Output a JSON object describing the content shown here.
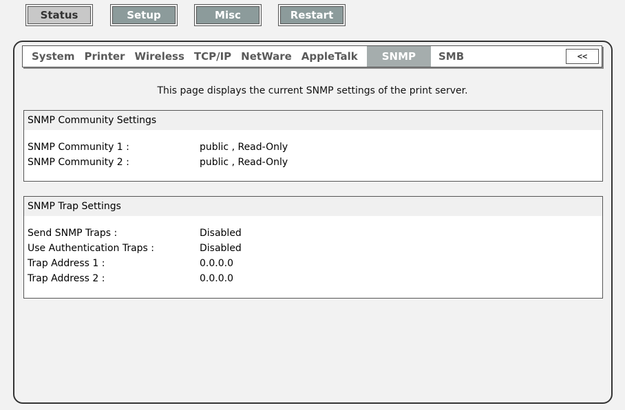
{
  "top_nav": {
    "status": "Status",
    "setup": "Setup",
    "misc": "Misc",
    "restart": "Restart"
  },
  "tabs": {
    "system": "System",
    "printer": "Printer",
    "wireless": "Wireless",
    "tcpip": "TCP/IP",
    "netware": "NetWare",
    "appletalk": "AppleTalk",
    "snmp": "SNMP",
    "smb": "SMB",
    "collapse": "<<"
  },
  "description": "This page displays the current SNMP settings of the print server.",
  "community": {
    "title": "SNMP Community Settings",
    "rows": [
      {
        "label": "SNMP Community 1 :",
        "value": "public , Read-Only"
      },
      {
        "label": "SNMP Community 2 :",
        "value": "public , Read-Only"
      }
    ]
  },
  "trap": {
    "title": "SNMP Trap Settings",
    "rows": [
      {
        "label": "Send SNMP Traps :",
        "value": "Disabled"
      },
      {
        "label": "Use Authentication Traps :",
        "value": "Disabled"
      },
      {
        "label": "Trap Address 1 :",
        "value": "0.0.0.0"
      },
      {
        "label": "Trap Address 2 :",
        "value": "0.0.0.0"
      }
    ]
  },
  "colors": {
    "active_tab_bg": "#a5adad",
    "inactive_button_bg": "#8c9b9b",
    "active_button_bg": "#c8c8c8"
  }
}
